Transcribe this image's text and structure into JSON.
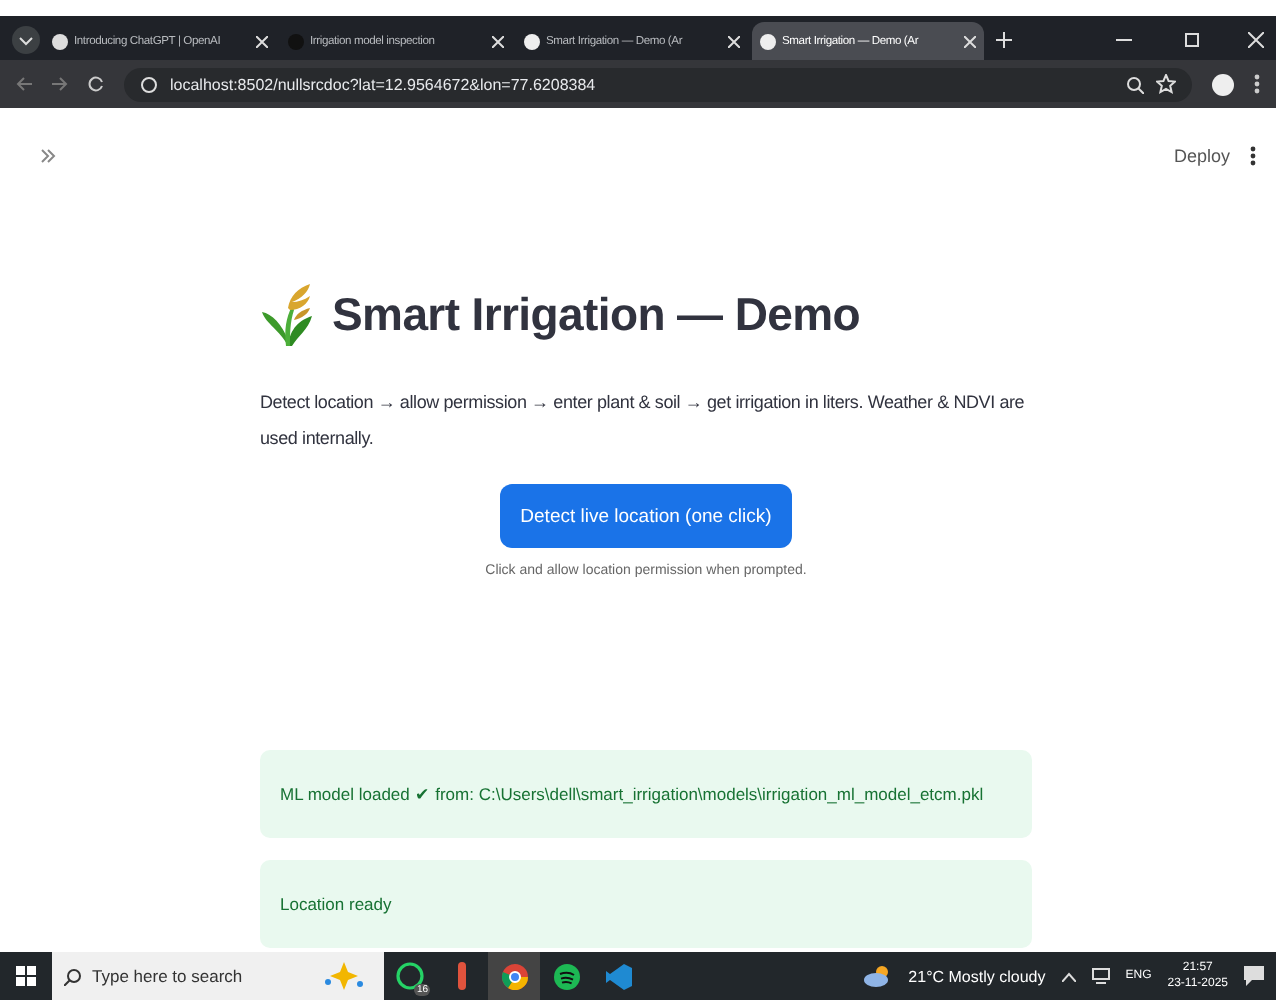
{
  "browser": {
    "tabs": [
      {
        "title": "Introducing ChatGPT | OpenAI",
        "selected": false
      },
      {
        "title": "Irrigation model inspection",
        "selected": false
      },
      {
        "title": "Smart Irrigation — Demo (Ar",
        "selected": false
      },
      {
        "title": "Smart Irrigation — Demo (Ar",
        "selected": true
      }
    ],
    "url": "localhost:8502/nullsrcdoc?lat=12.9564672&lon=77.6208384"
  },
  "app_header": {
    "deploy": "Deploy"
  },
  "page": {
    "title": "Smart Irrigation — Demo",
    "description": "Detect location → allow permission → enter plant & soil → get irrigation in liters. Weather & NDVI are used internally.",
    "button": "Detect live location (one click)",
    "hint": "Click and allow location permission when prompted.",
    "alerts": [
      {
        "text": "ML model loaded ✔ from: C:\\Users\\dell\\smart_irrigation\\models\\irrigation_ml_model_etcm.pkl"
      },
      {
        "text": "Location ready"
      }
    ]
  },
  "taskbar": {
    "search_placeholder": "Type here to search",
    "whatsapp_badge": "16",
    "weather": "21°C  Mostly cloudy",
    "language": "ENG",
    "time": "21:57",
    "date": "23-11-2025"
  }
}
